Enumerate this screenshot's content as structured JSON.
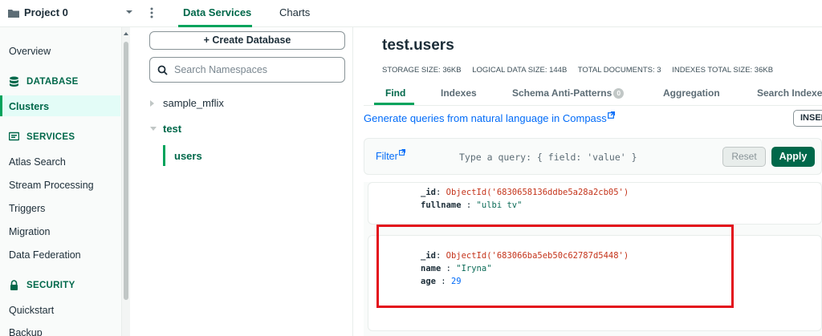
{
  "topbar": {
    "project": "Project 0",
    "tabs": [
      "Data Services",
      "Charts"
    ]
  },
  "sidebar": {
    "overview": "Overview",
    "database_header": "DATABASE",
    "clusters": "Clusters",
    "services_header": "SERVICES",
    "services": [
      "Atlas Search",
      "Stream Processing",
      "Triggers",
      "Migration",
      "Data Federation"
    ],
    "security_header": "SECURITY",
    "security": [
      "Quickstart",
      "Backup"
    ]
  },
  "namespaces": {
    "create_label": "+ Create Database",
    "search_placeholder": "Search Namespaces",
    "databases": [
      {
        "name": "sample_mflix",
        "expanded": false
      },
      {
        "name": "test",
        "expanded": true,
        "collections": [
          "users"
        ]
      }
    ]
  },
  "collection": {
    "title": "test.users",
    "stats": [
      "STORAGE SIZE: 36KB",
      "LOGICAL DATA SIZE: 144B",
      "TOTAL DOCUMENTS: 3",
      "INDEXES TOTAL SIZE: 36KB"
    ],
    "tabs": [
      "Find",
      "Indexes",
      "Schema Anti-Patterns",
      "Aggregation",
      "Search Indexes"
    ],
    "schema_badge": "0",
    "compass_link": "Generate queries from natural language in Compass",
    "insert_label": "INSERT"
  },
  "filter": {
    "label": "Filter",
    "placeholder": "Type a query: { field: 'value' }",
    "reset": "Reset",
    "apply": "Apply"
  },
  "documents": [
    {
      "id_key": "_id",
      "id_val": "ObjectId('6830658136ddbe5a28a2cb05')",
      "f1_key": "fullname",
      "f1_val": "\"ulbi tv\""
    },
    {
      "id_key": "_id",
      "id_val": "ObjectId('683066ba5eb50c62787d5448')",
      "f1_key": "name",
      "f1_val": "\"Iryna\"",
      "f2_key": "age",
      "f2_val": "29"
    }
  ],
  "colors": {
    "accent": "#00684a",
    "accent_light": "#00a35c",
    "link": "#016bf8",
    "highlight": "#e3101c"
  }
}
